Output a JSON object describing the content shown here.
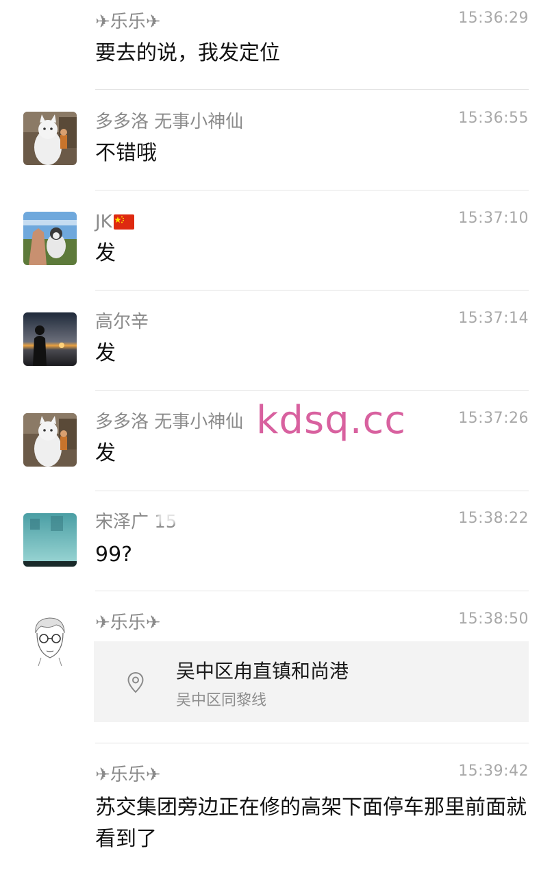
{
  "messages": [
    {
      "sender": "✈乐乐✈",
      "time": "15:36:29",
      "text": "要去的说，我发定位"
    },
    {
      "sender": "多多洛 无事小神仙",
      "time": "15:36:55",
      "text": "不错哦"
    },
    {
      "sender": "JK",
      "time": "15:37:10",
      "text": "发",
      "flag": "china-flag-icon"
    },
    {
      "sender": "高尔辛",
      "time": "15:37:14",
      "text": "发"
    },
    {
      "sender": "多多洛 无事小神仙",
      "time": "15:37:26",
      "text": "发"
    },
    {
      "sender": "宋泽广 15",
      "time": "15:38:22",
      "text": "99?"
    },
    {
      "sender": "✈乐乐✈",
      "time": "15:38:50",
      "location": {
        "title": "吴中区甪直镇和尚港",
        "subtitle": "吴中区同黎线",
        "icon": "location-pin-icon"
      }
    },
    {
      "sender": "✈乐乐✈",
      "time": "15:39:42",
      "text": "苏交集团旁边正在修的高架下面停车那里前面就看到了"
    }
  ],
  "watermark": "kdsq.cc",
  "colors": {
    "sender": "#8a8a8a",
    "time": "#a8a8a8",
    "text": "#111111",
    "divider": "#e3e3e3",
    "card": "#f3f3f3",
    "watermark": "#d8619f"
  }
}
